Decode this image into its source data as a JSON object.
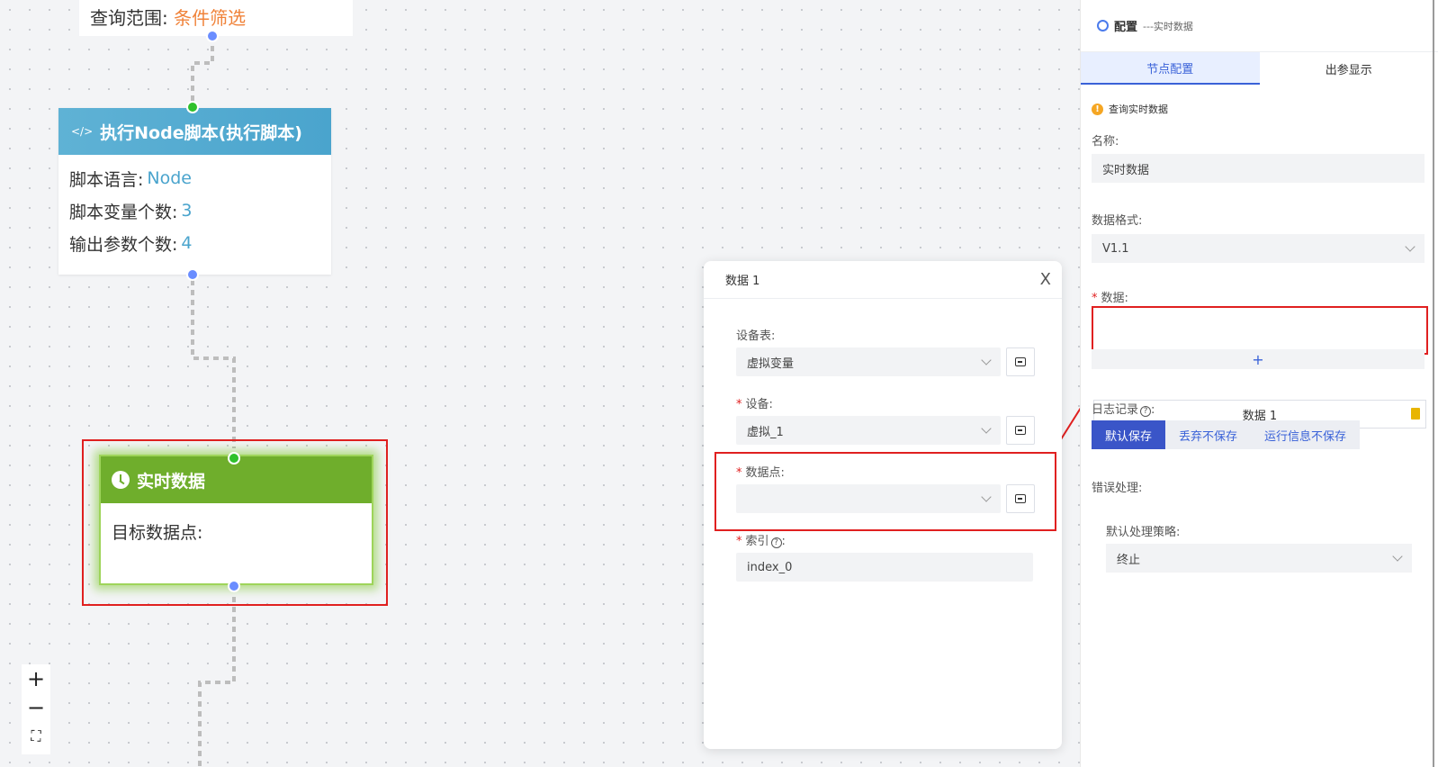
{
  "canvas": {
    "top_node": {
      "label": "查询范围:",
      "value": "条件筛选"
    },
    "script_node": {
      "title": "执行Node脚本(执行脚本)",
      "icon_text": "</>",
      "rows": [
        {
          "label": "脚本语言:",
          "value": "Node"
        },
        {
          "label": "脚本变量个数:",
          "value": "3"
        },
        {
          "label": "输出参数个数:",
          "value": "4"
        }
      ]
    },
    "realtime_node": {
      "title": "实时数据",
      "body": "目标数据点:"
    },
    "zoom": {
      "in": "+",
      "out": "−",
      "fit": "⛶"
    }
  },
  "modal": {
    "title": "数据 1",
    "close": "X",
    "fields": [
      {
        "label": "设备表:",
        "value": "虚拟变量",
        "required": false
      },
      {
        "label": "设备:",
        "value": "虚拟_1",
        "required": true
      },
      {
        "label": "数据点:",
        "value": "",
        "required": true
      }
    ],
    "index": {
      "label": "索引",
      "value": "index_0",
      "required": true
    }
  },
  "panel": {
    "title": "配置",
    "subtitle": "---实时数据",
    "tabs": [
      "节点配置",
      "出参显示"
    ],
    "notice": "查询实时数据",
    "name_label": "名称:",
    "name_value": "实时数据",
    "format_label": "数据格式:",
    "format_value": "V1.1",
    "data_label": "数据:",
    "data_item": "数据 1",
    "add": "+",
    "log_label": "日志记录",
    "log_options": [
      "默认保存",
      "丢弃不保存",
      "运行信息不保存"
    ],
    "error_label": "错误处理:",
    "policy_label": "默认处理策略:",
    "policy_value": "终止"
  },
  "colors": {
    "accent": "#3a55c8",
    "highlight": "#e02020",
    "node_green": "#6fae2c",
    "node_blue": "#4aa4cd"
  }
}
